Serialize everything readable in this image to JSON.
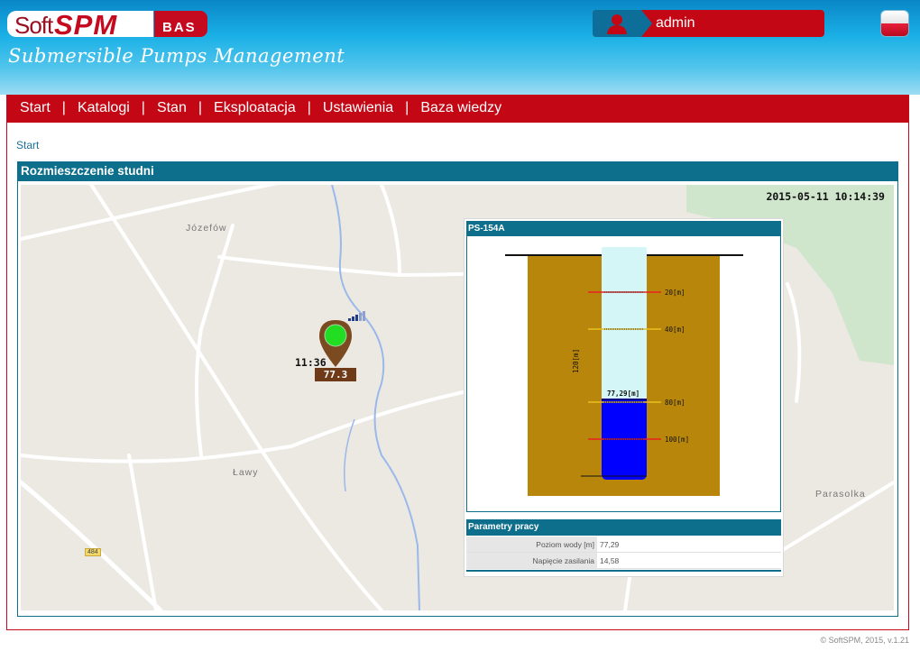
{
  "brand": {
    "soft": "Soft",
    "spm": "SPM",
    "bas": "BAS",
    "tagline": "Submersible Pumps Management"
  },
  "user": {
    "name": "admin",
    "icon": "user-icon"
  },
  "language": {
    "icon": "flag-pl-icon",
    "colors": [
      "#ffffff",
      "#d4102b"
    ]
  },
  "nav": {
    "items": [
      "Start",
      "Katalogi",
      "Stan",
      "Eksploatacja",
      "Ustawienia",
      "Baza wiedzy"
    ],
    "separator": "|"
  },
  "breadcrumb": "Start",
  "panel": {
    "title": "Rozmieszczenie studni"
  },
  "map": {
    "timestamp": "2015-05-11 10:14:39",
    "places": [
      "Józefów",
      "Ławy",
      "Parasolka"
    ],
    "road_number": "484",
    "well_marker": {
      "time": "11:36",
      "value": "77.3",
      "status_color": "#22dd22",
      "icon": "map-pin-icon",
      "signal_icon": "signal-strength-icon"
    }
  },
  "popup": {
    "title": "PS-154A",
    "diagram": {
      "total_depth_label": "120[m]",
      "water_level_label": "77,29[m]",
      "depth_marks": [
        {
          "label": "20[m]",
          "color": "#e82020"
        },
        {
          "label": "40[m]",
          "color": "#e8c020"
        },
        {
          "label": "80[m]",
          "color": "#e8c020"
        },
        {
          "label": "100[m]",
          "color": "#e82020"
        }
      ],
      "colors": {
        "ground": "#b8860b",
        "well_empty": "#d4f6f6",
        "water": "#0000ff"
      }
    },
    "params_title": "Parametry pracy",
    "params": [
      {
        "label": "Poziom wody [m]",
        "value": "77,29"
      },
      {
        "label": "Napięcie zasilania",
        "value": "14,58"
      }
    ]
  },
  "footer": "© SoftSPM, 2015, v.1.21",
  "colors": {
    "brand_red": "#c30715",
    "header_blue": "#0a86c7",
    "panel_teal": "#0d6f8c"
  }
}
